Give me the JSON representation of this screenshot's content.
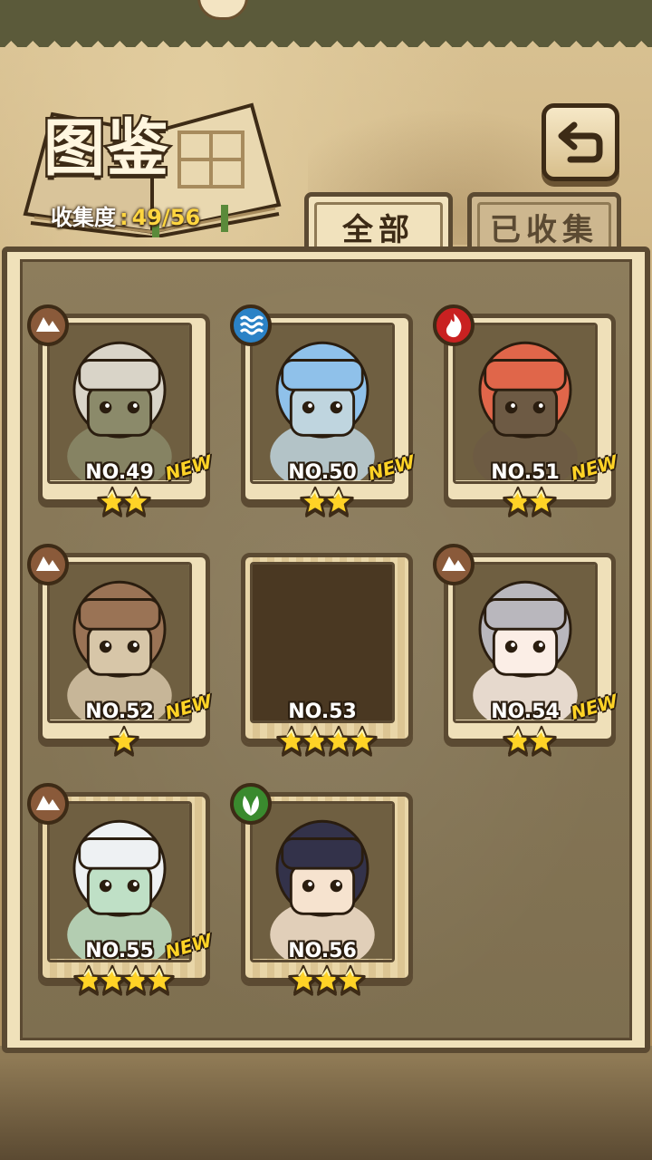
{
  "header": {
    "title": "图鉴",
    "progress_label": "收集度",
    "progress_sep": ":",
    "progress_value": "49/56"
  },
  "tabs": [
    {
      "label": "全部",
      "active": true
    },
    {
      "label": "已收集",
      "active": false
    }
  ],
  "colors": {
    "accent_gold": "#ffd640",
    "frame_dark": "#5b4a32",
    "parchment": "#f0e1ba"
  },
  "cards": [
    {
      "number": "NO.49",
      "element": "earth-icon",
      "stars": 2,
      "is_new": true,
      "new_label": "NEW",
      "locked": false,
      "hair": "#d9d4c8",
      "skin": "#8b8a6a"
    },
    {
      "number": "NO.50",
      "element": "water-icon",
      "stars": 2,
      "is_new": true,
      "new_label": "NEW",
      "locked": false,
      "hair": "#8fc1ea",
      "skin": "#bfd5df"
    },
    {
      "number": "NO.51",
      "element": "fire-icon",
      "stars": 2,
      "is_new": true,
      "new_label": "NEW",
      "locked": false,
      "hair": "#e0664a",
      "skin": "#6d5a44"
    },
    {
      "number": "NO.52",
      "element": "earth-icon",
      "stars": 1,
      "is_new": true,
      "new_label": "NEW",
      "locked": false,
      "hair": "#9a7355",
      "skin": "#d7c6a8"
    },
    {
      "number": "NO.53",
      "element": "",
      "stars": 4,
      "is_new": false,
      "new_label": "",
      "locked": true,
      "hair": "",
      "skin": ""
    },
    {
      "number": "NO.54",
      "element": "earth-icon",
      "stars": 2,
      "is_new": true,
      "new_label": "NEW",
      "locked": false,
      "hair": "#b9b7bd",
      "skin": "#fbeee6"
    },
    {
      "number": "NO.55",
      "element": "earth-icon",
      "stars": 4,
      "is_new": true,
      "new_label": "NEW",
      "locked": false,
      "hair": "#eef1f3",
      "skin": "#bfe0c6"
    },
    {
      "number": "NO.56",
      "element": "wood-icon",
      "stars": 3,
      "is_new": false,
      "new_label": "",
      "locked": false,
      "hair": "#33324a",
      "skin": "#f6e3cf"
    }
  ]
}
